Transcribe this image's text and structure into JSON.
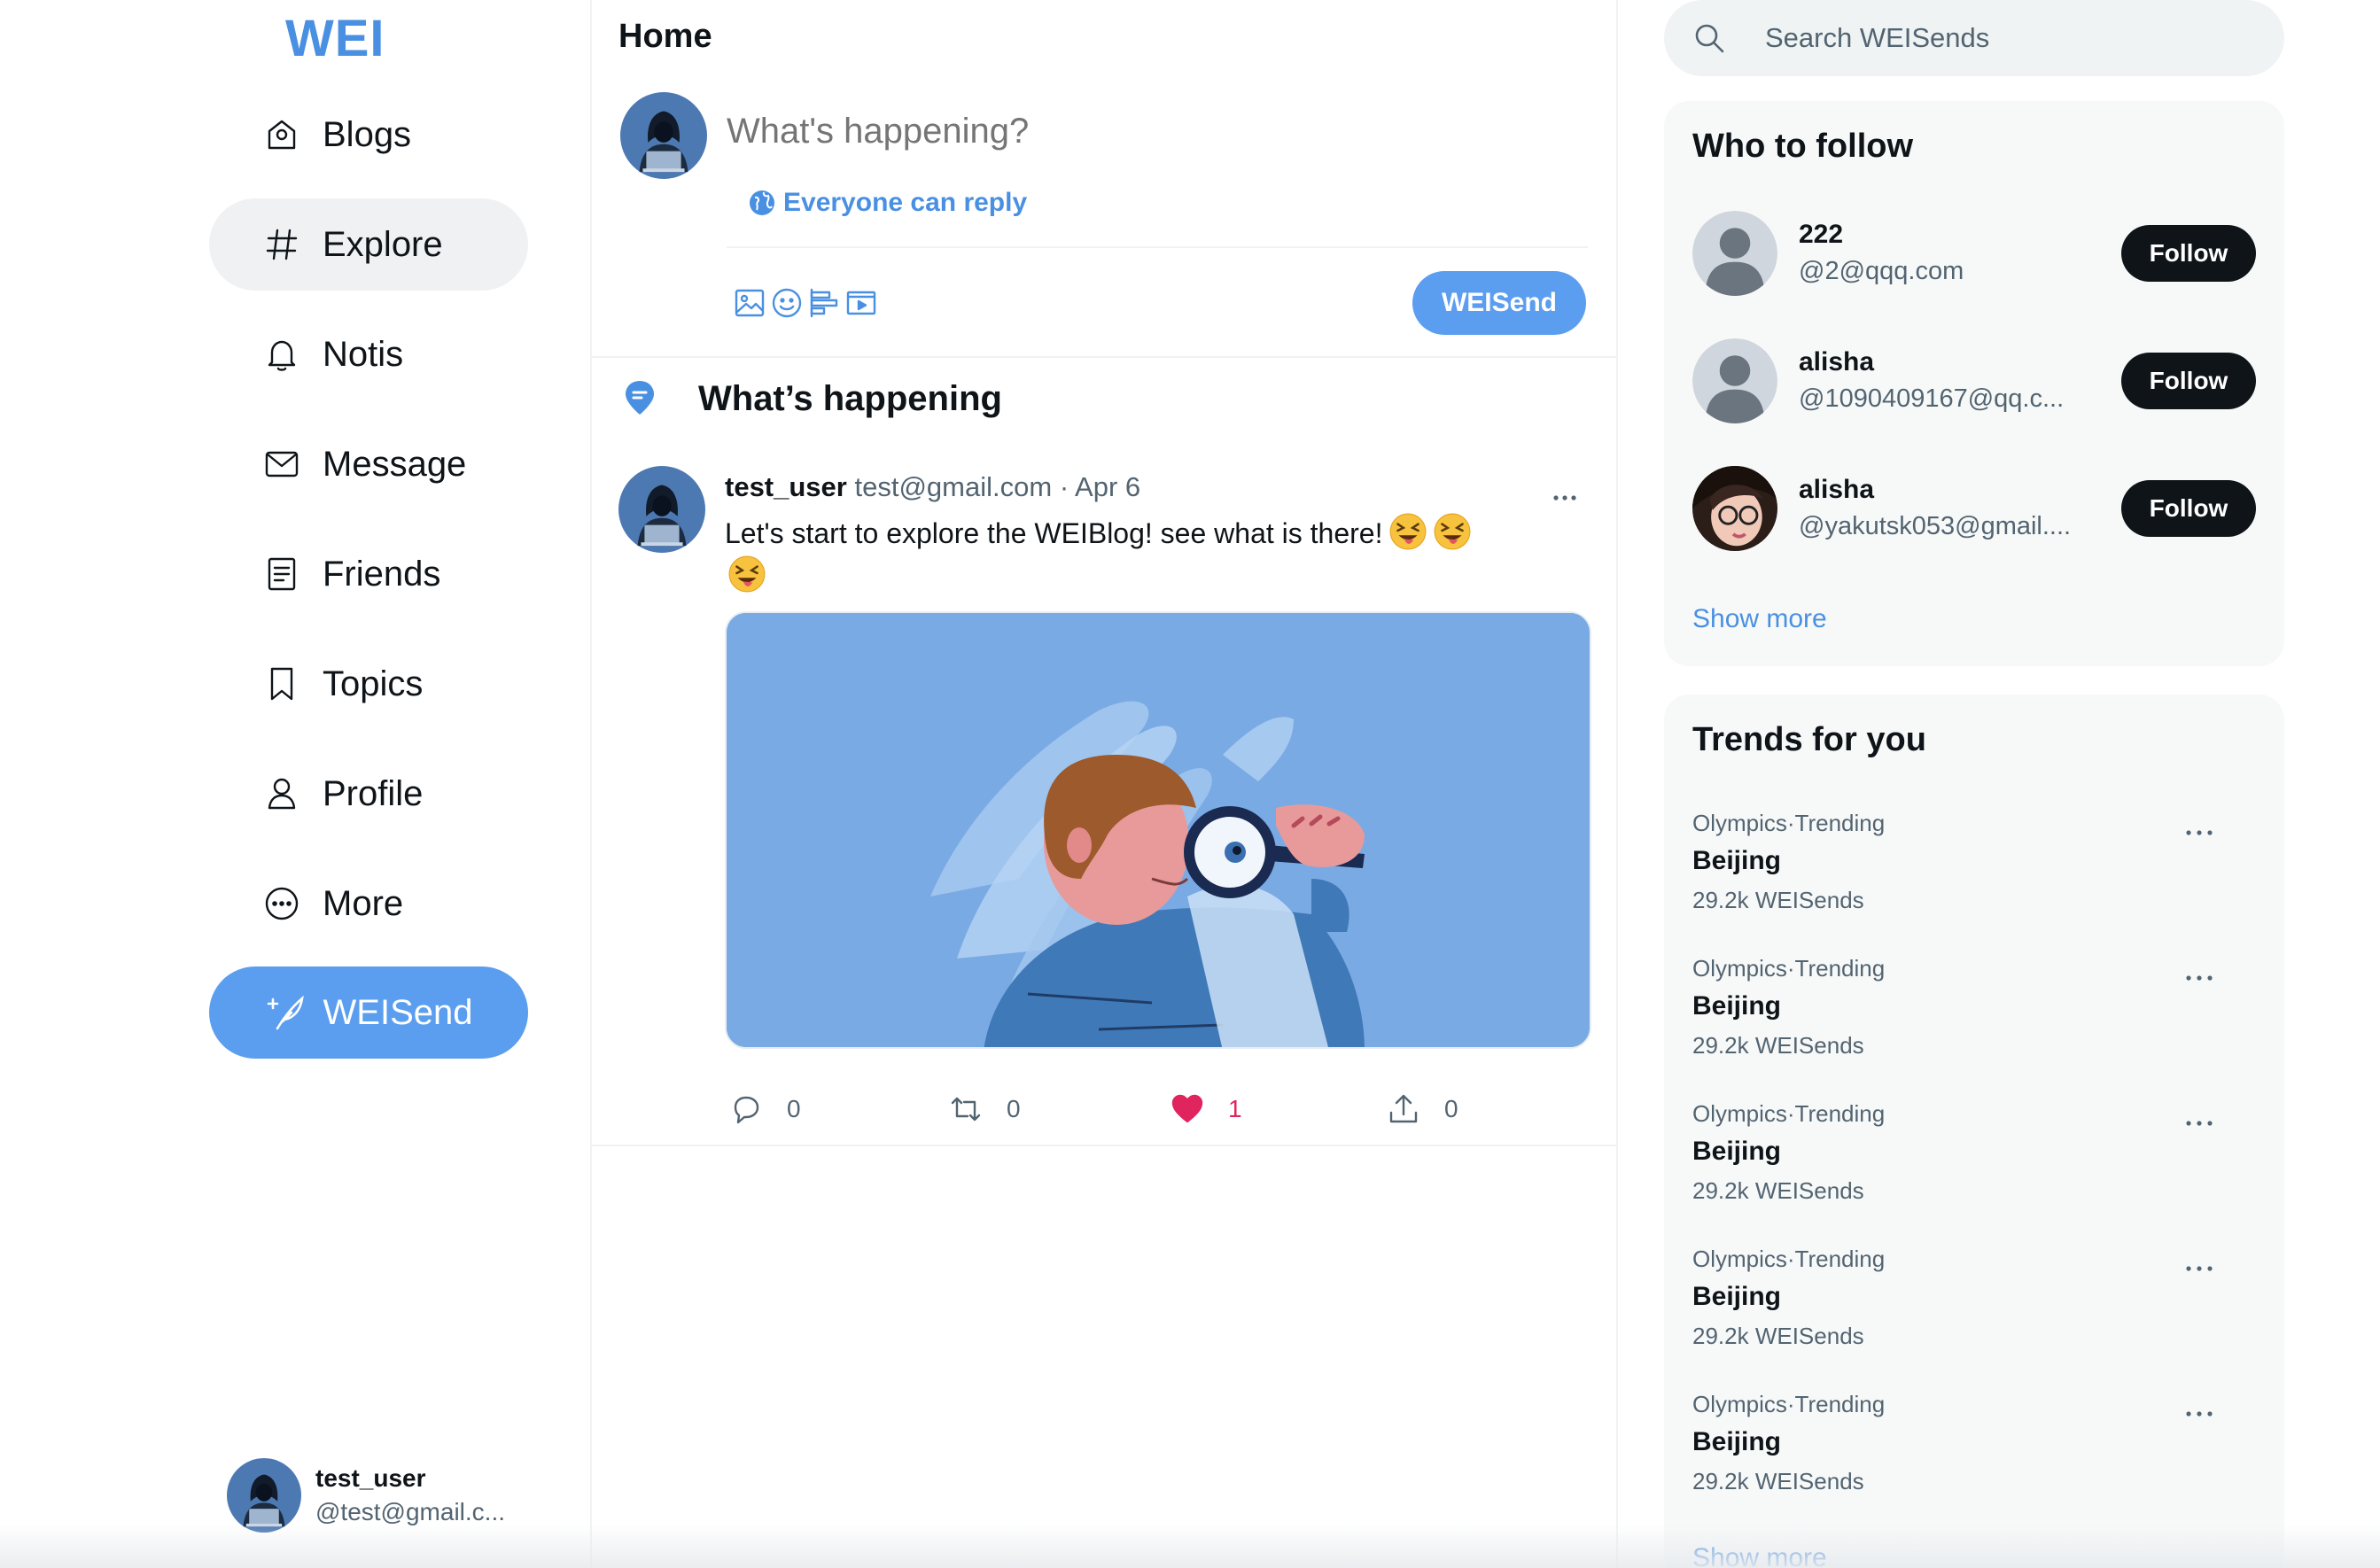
{
  "app": {
    "logo": "WEI"
  },
  "sidebar": {
    "items": [
      {
        "label": "Blogs",
        "icon": "home-icon"
      },
      {
        "label": "Explore",
        "icon": "hashtag-icon",
        "active": true
      },
      {
        "label": "Notis",
        "icon": "bell-icon"
      },
      {
        "label": "Message",
        "icon": "mail-icon"
      },
      {
        "label": "Friends",
        "icon": "list-icon"
      },
      {
        "label": "Topics",
        "icon": "bookmark-icon"
      },
      {
        "label": "Profile",
        "icon": "user-icon"
      },
      {
        "label": "More",
        "icon": "more-circle-icon"
      }
    ],
    "send_label": "WEISend",
    "account": {
      "name": "test_user",
      "handle": "@test@gmail.c..."
    }
  },
  "main": {
    "title": "Home",
    "composer": {
      "placeholder": "What's happening?",
      "reply_scope": "Everyone can reply",
      "tools": [
        "image-icon",
        "emoji-icon",
        "poll-icon",
        "video-icon"
      ],
      "post_label": "WEISend"
    },
    "section_title": "What’s happening",
    "post": {
      "author": "test_user",
      "handle": "test@gmail.com",
      "date": "· Apr 6",
      "text": "Let's start to explore the WEIBlog! see what is there!",
      "emoji_count": 3,
      "actions": {
        "reply": "0",
        "repost": "0",
        "like": "1",
        "share": "0"
      }
    }
  },
  "right": {
    "search": {
      "placeholder": "Search WEISends"
    },
    "who_to_follow": {
      "title": "Who to follow",
      "users": [
        {
          "name": "222",
          "handle": "@2@qqq.com",
          "button": "Follow",
          "avatar": "default"
        },
        {
          "name": "alisha",
          "handle": "@1090409167@qq.c...",
          "button": "Follow",
          "avatar": "default"
        },
        {
          "name": "alisha",
          "handle": "@yakutsk053@gmail....",
          "button": "Follow",
          "avatar": "photo"
        }
      ],
      "show_more": "Show more"
    },
    "trends": {
      "title": "Trends for you",
      "items": [
        {
          "context": "Olympics·Trending",
          "name": "Beijing",
          "count": "29.2k WEISends"
        },
        {
          "context": "Olympics·Trending",
          "name": "Beijing",
          "count": "29.2k WEISends"
        },
        {
          "context": "Olympics·Trending",
          "name": "Beijing",
          "count": "29.2k WEISends"
        },
        {
          "context": "Olympics·Trending",
          "name": "Beijing",
          "count": "29.2k WEISends"
        },
        {
          "context": "Olympics·Trending",
          "name": "Beijing",
          "count": "29.2k WEISends"
        }
      ],
      "show_more": "Show more"
    }
  },
  "colors": {
    "accent": "#4a90e2",
    "button": "#5b9eef",
    "like": "#e0245e",
    "follow": "#0f1419"
  }
}
